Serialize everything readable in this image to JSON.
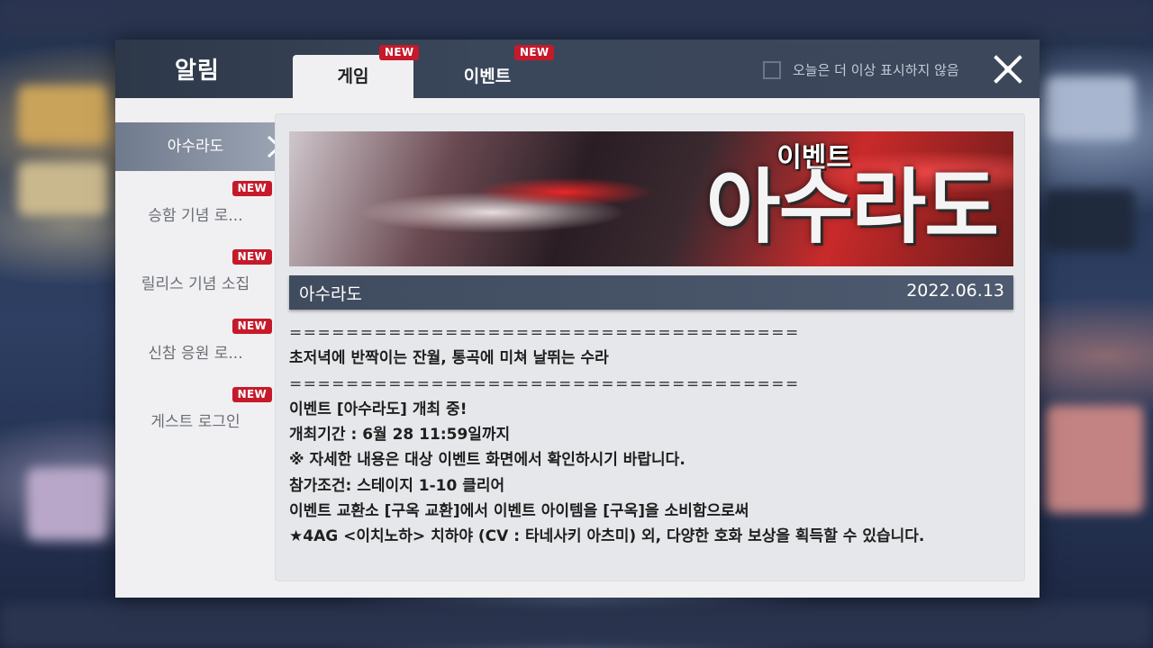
{
  "header": {
    "title": "알림",
    "tabs": [
      {
        "label": "게임",
        "badge": "NEW",
        "active": true
      },
      {
        "label": "이벤트",
        "badge": "NEW",
        "active": false
      }
    ],
    "dont_show_today": "오늘은 더 이상 표시하지 않음"
  },
  "sidebar": {
    "items": [
      {
        "label": "아수라도",
        "active": true,
        "badge": ""
      },
      {
        "label": "승함 기념 로...",
        "active": false,
        "badge": "NEW"
      },
      {
        "label": "릴리스 기념 소집",
        "active": false,
        "badge": "NEW"
      },
      {
        "label": "신참 응원 로...",
        "active": false,
        "badge": "NEW"
      },
      {
        "label": "게스트 로그인",
        "active": false,
        "badge": "NEW"
      }
    ]
  },
  "notice": {
    "banner_subtitle": "이벤트",
    "banner_title": "아수라도",
    "title": "아수라도",
    "date": "2022.06.13",
    "lines": [
      "====================================",
      "초저녁에 반짝이는 잔월, 통곡에 미쳐 날뛰는 수라",
      "====================================",
      "이벤트 [아수라도] 개최 중!",
      "개최기간 : 6월 28 11:59일까지",
      "※ 자세한 내용은 대상 이벤트 화면에서 확인하시기 바랍니다.",
      "참가조건: 스테이지 1-10 클리어",
      "이벤트 교환소 [구옥 교환]에서 이벤트 아이템을 [구옥]을 소비함으로써",
      "★4AG <이치노하> 치하야 (CV : 타네사키 아츠미) 외, 다양한 호화 보상을 획득할 수 있습니다."
    ]
  },
  "colors": {
    "badge": "#c61a2b",
    "header_bg": "#3a465a",
    "panel_bg": "#f0f0f2"
  }
}
